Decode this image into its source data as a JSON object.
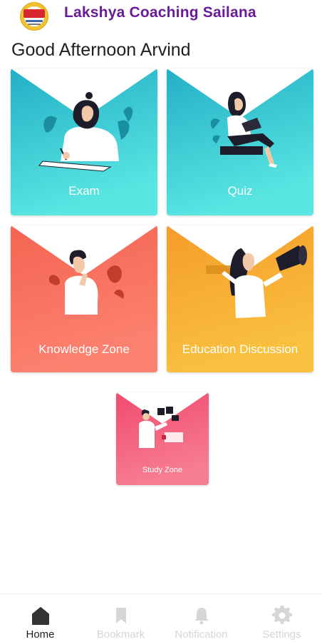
{
  "app": {
    "title": "Lakshya Coaching Sailana",
    "logo_icon": "lakshya-logo"
  },
  "greeting": "Good Afternoon Arvind",
  "cards": [
    {
      "id": "exam",
      "label": "Exam",
      "color_top": "#27b6c8",
      "color_bottom": "#5ee3e3",
      "illustration": "student-writing-illustration"
    },
    {
      "id": "quiz",
      "label": "Quiz",
      "color_top": "#27b6c8",
      "color_bottom": "#5ee3e3",
      "illustration": "student-reading-illustration"
    },
    {
      "id": "knowledge",
      "label": "Knowledge Zone",
      "color_top": "#f56c5a",
      "color_bottom": "#fb7f6c",
      "illustration": "thinking-man-illustration"
    },
    {
      "id": "education",
      "label": "Education Discussion",
      "color_top": "#f5a02c",
      "color_bottom": "#f9bd3d",
      "illustration": "woman-megaphone-illustration"
    },
    {
      "id": "study",
      "label": "Study Zone",
      "color_top": "#f14b6e",
      "color_bottom": "#f77b91",
      "illustration": "man-with-board-illustration"
    }
  ],
  "bottom_nav": [
    {
      "label": "Home",
      "icon": "home-icon",
      "active": true
    },
    {
      "label": "Bookmark",
      "icon": "bookmark-icon",
      "active": false
    },
    {
      "label": "Notification",
      "icon": "bell-icon",
      "active": false
    },
    {
      "label": "Settings",
      "icon": "gear-icon",
      "active": false
    }
  ],
  "colors": {
    "title": "#6a1b9a",
    "nav_active": "#333333",
    "nav_inactive": "#d6d6d6"
  }
}
